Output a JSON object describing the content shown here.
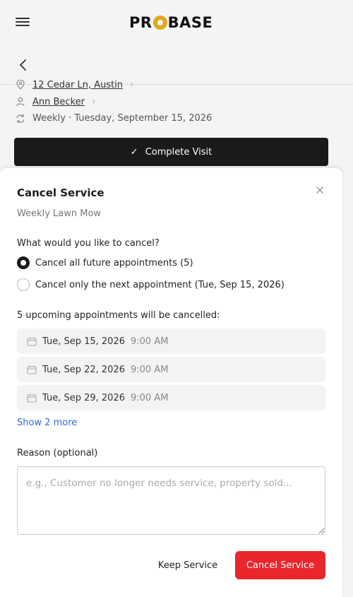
{
  "app": {
    "logo_text_left": "PR",
    "logo_text_right": "BASE",
    "brand_color": "#e0a91e"
  },
  "background": {
    "address": "12 Cedar Ln, Austin",
    "customer": "Ann Becker",
    "schedule": "Weekly · Tuesday, September 15, 2026",
    "complete_visit_label": "Complete Visit"
  },
  "modal": {
    "title": "Cancel Service",
    "subtitle": "Weekly Lawn Mow",
    "question": "What would you like to cancel?",
    "options": [
      {
        "label": "Cancel all future appointments (5)",
        "selected": true
      },
      {
        "label": "Cancel only the next appointment (Tue, Sep 15, 2026)",
        "selected": false
      }
    ],
    "upcoming_label": "5 upcoming appointments will be cancelled:",
    "appointments": [
      {
        "date": "Tue, Sep 15, 2026",
        "time": "9:00 AM"
      },
      {
        "date": "Tue, Sep 22, 2026",
        "time": "9:00 AM"
      },
      {
        "date": "Tue, Sep 29, 2026",
        "time": "9:00 AM"
      }
    ],
    "show_more": "Show 2 more",
    "reason_label": "Reason (optional)",
    "reason_placeholder": "e.g., Customer no longer needs service, property sold...",
    "reason_value": "",
    "keep_label": "Keep Service",
    "cancel_label": "Cancel Service",
    "danger_color": "#e8262c"
  }
}
